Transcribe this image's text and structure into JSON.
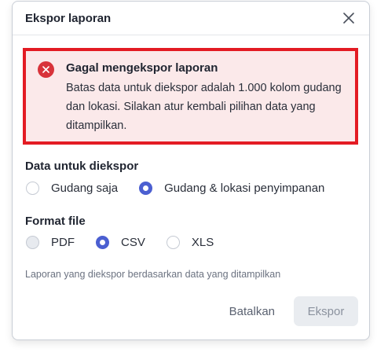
{
  "dialog": {
    "title": "Ekspor laporan",
    "close_icon": "close-icon"
  },
  "alert": {
    "icon": "error-x-icon",
    "title": "Gagal mengekspor laporan",
    "message": "Batas data untuk diekspor adalah 1.000 kolom gudang dan lokasi. Silakan atur kembali pilihan data yang ditampilkan.",
    "border_color": "#e31b23",
    "background_color": "#fbe9ea"
  },
  "data_section": {
    "label": "Data untuk diekspor",
    "options": [
      {
        "label": "Gudang saja",
        "selected": false
      },
      {
        "label": "Gudang & lokasi penyimpanan",
        "selected": true
      }
    ]
  },
  "format_section": {
    "label": "Format file",
    "options": [
      {
        "label": "PDF",
        "selected": false
      },
      {
        "label": "CSV",
        "selected": true
      },
      {
        "label": "XLS",
        "selected": false
      }
    ]
  },
  "hint": "Laporan yang diekspor berdasarkan data yang ditampilkan",
  "footer": {
    "cancel_label": "Batalkan",
    "export_label": "Ekspor"
  },
  "colors": {
    "accent": "#4b5fd1",
    "error": "#d8333a"
  }
}
